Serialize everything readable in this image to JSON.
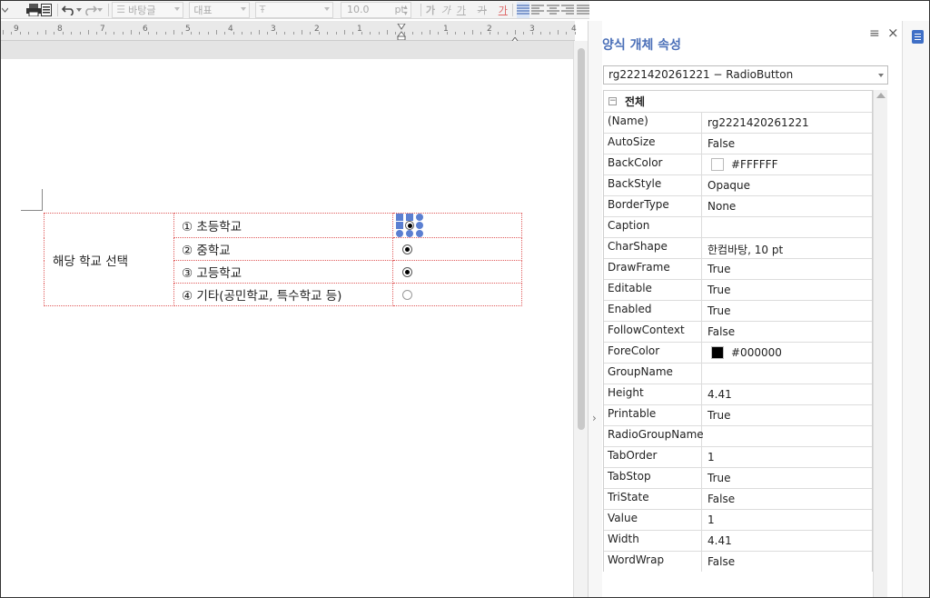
{
  "toolbar": {
    "style_combo": "바탕글",
    "font_lang_combo": "대표",
    "font_combo": "",
    "font_size": "10.0",
    "font_unit": "pt",
    "format_buttons": [
      "가",
      "가",
      "가",
      "가",
      "가"
    ]
  },
  "ruler": {
    "numbers": [
      "9",
      "8",
      "7",
      "6",
      "5",
      "4",
      "3",
      "2",
      "1",
      "1",
      "2",
      "3",
      "4"
    ]
  },
  "document": {
    "label_cell": "해당 학교 선택",
    "options": [
      {
        "text": "① 초등학교",
        "state": "selected-control"
      },
      {
        "text": "② 중학교",
        "state": "checked"
      },
      {
        "text": "③ 고등학교",
        "state": "checked"
      },
      {
        "text": "④ 기타(공민학교, 특수학교 등)",
        "state": "unchecked"
      }
    ]
  },
  "panel": {
    "title": "양식 개체 속성",
    "object_select": "rg2221420261221 − RadioButton",
    "category": "전체",
    "category_toggle": "−",
    "properties": [
      {
        "name": "(Name)",
        "value": "rg2221420261221"
      },
      {
        "name": "AutoSize",
        "value": "False"
      },
      {
        "name": "BackColor",
        "value": "#FFFFFF",
        "swatch": "#FFFFFF"
      },
      {
        "name": "BackStyle",
        "value": "Opaque"
      },
      {
        "name": "BorderType",
        "value": "None"
      },
      {
        "name": "Caption",
        "value": ""
      },
      {
        "name": "CharShape",
        "value": "한컴바탕, 10 pt"
      },
      {
        "name": "DrawFrame",
        "value": "True"
      },
      {
        "name": "Editable",
        "value": "True"
      },
      {
        "name": "Enabled",
        "value": "True"
      },
      {
        "name": "FollowContext",
        "value": "False"
      },
      {
        "name": "ForeColor",
        "value": "#000000",
        "swatch": "#000000"
      },
      {
        "name": "GroupName",
        "value": ""
      },
      {
        "name": "Height",
        "value": "4.41"
      },
      {
        "name": "Printable",
        "value": "True"
      },
      {
        "name": "RadioGroupName",
        "value": ""
      },
      {
        "name": "TabOrder",
        "value": "1"
      },
      {
        "name": "TabStop",
        "value": "True"
      },
      {
        "name": "TriState",
        "value": "False"
      },
      {
        "name": "Value",
        "value": "1"
      },
      {
        "name": "Width",
        "value": "4.41"
      },
      {
        "name": "WordWrap",
        "value": "False"
      }
    ]
  },
  "colors": {
    "accent": "#4a6fb8",
    "selection": "#5b7fd1",
    "cell_border": "#e05a5a"
  }
}
